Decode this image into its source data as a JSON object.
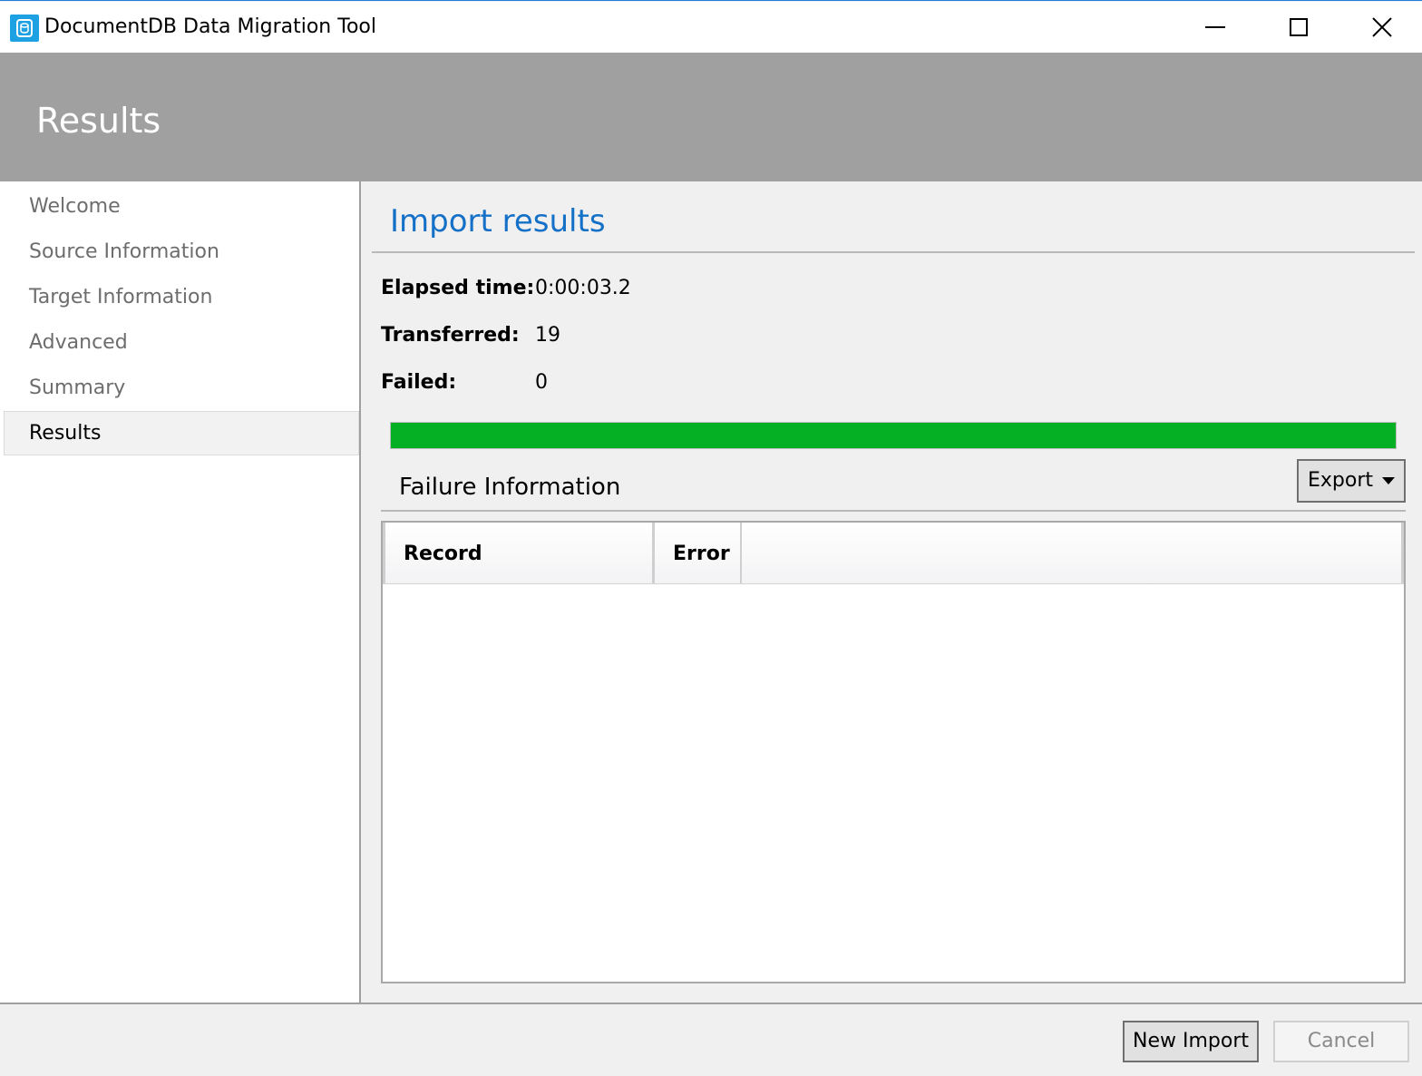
{
  "window": {
    "title": "DocumentDB Data Migration Tool",
    "icon": "database-icon",
    "controls": [
      "minimize-icon",
      "maximize-icon",
      "close-icon"
    ]
  },
  "header": {
    "title": "Results"
  },
  "sidebar": {
    "items": [
      {
        "label": "Welcome",
        "active": false
      },
      {
        "label": "Source Information",
        "active": false
      },
      {
        "label": "Target Information",
        "active": false
      },
      {
        "label": "Advanced",
        "active": false
      },
      {
        "label": "Summary",
        "active": false
      },
      {
        "label": "Results",
        "active": true
      }
    ]
  },
  "main": {
    "section_title": "Import results",
    "stats": {
      "elapsed_label": "Elapsed time:",
      "elapsed_value": "0:00:03.2",
      "transferred_label": "Transferred:",
      "transferred_value": "19",
      "failed_label": "Failed:",
      "failed_value": "0"
    },
    "progress_percent": 100,
    "progress_color": "#06b025",
    "failure_title": "Failure Information",
    "export_label": "Export",
    "grid": {
      "columns": [
        "Record",
        "Error"
      ],
      "rows": []
    }
  },
  "footer": {
    "new_import_label": "New Import",
    "cancel_label": "Cancel",
    "cancel_enabled": false
  },
  "colors": {
    "accent": "#1571c7",
    "header_band": "#a0a0a0",
    "progress": "#06b025"
  }
}
